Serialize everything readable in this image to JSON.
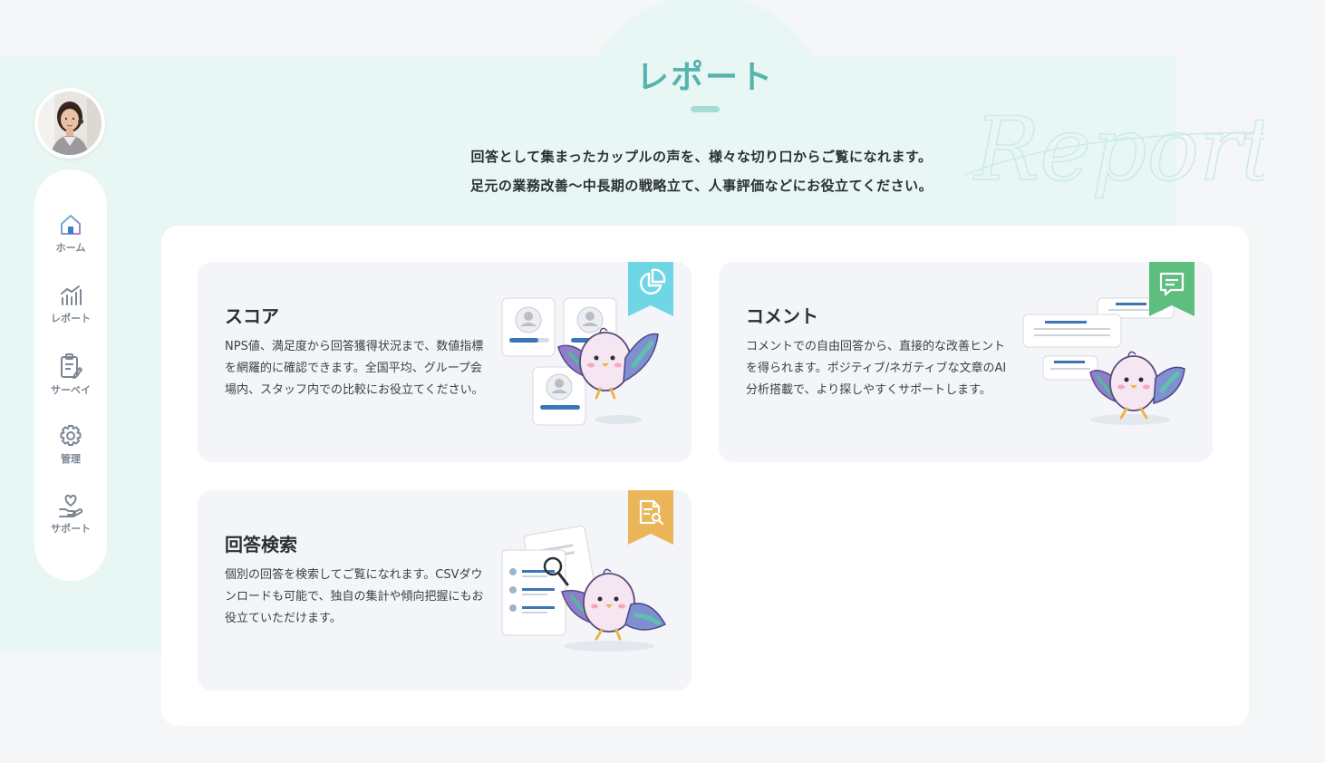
{
  "page": {
    "title": "レポート",
    "intro_line1": "回答として集まったカップルの声を、様々な切り口からご覧になれます。",
    "intro_line2": "足元の業務改善〜中長期の戦略立て、人事評価などにお役立てください。",
    "watermark_text": "Report"
  },
  "sidebar": {
    "items": [
      {
        "label": "ホーム",
        "icon": "home-icon"
      },
      {
        "label": "レポート",
        "icon": "chart-icon"
      },
      {
        "label": "サーベイ",
        "icon": "clipboard-icon"
      },
      {
        "label": "管理",
        "icon": "gear-icon"
      },
      {
        "label": "サポート",
        "icon": "heart-hand-icon"
      }
    ]
  },
  "cards": [
    {
      "title": "スコア",
      "description": "NPS値、満足度から回答獲得状況まで、数値指標を網羅的に確認できます。全国平均、グループ会場内、スタッフ内での比較にお役立てください。",
      "ribbon_color": "#6fd6e6",
      "icon": "pie-chart-icon"
    },
    {
      "title": "コメント",
      "description": "コメントでの自由回答から、直接的な改善ヒントを得られます。ポジティブ/ネガティブな文章のAI分析搭載で、より探しやすくサポートします。",
      "ribbon_color": "#5dbe7e",
      "icon": "comment-icon"
    },
    {
      "title": "回答検索",
      "description": "個別の回答を検索してご覧になれます。CSVダウンロードも可能で、独自の集計や傾向把握にもお役立ていただけます。",
      "ribbon_color": "#eab659",
      "icon": "document-search-icon"
    }
  ],
  "colors": {
    "accent": "#56b3ad",
    "mint_background": "#e8f7f3",
    "card_background": "#f4f5f9"
  }
}
